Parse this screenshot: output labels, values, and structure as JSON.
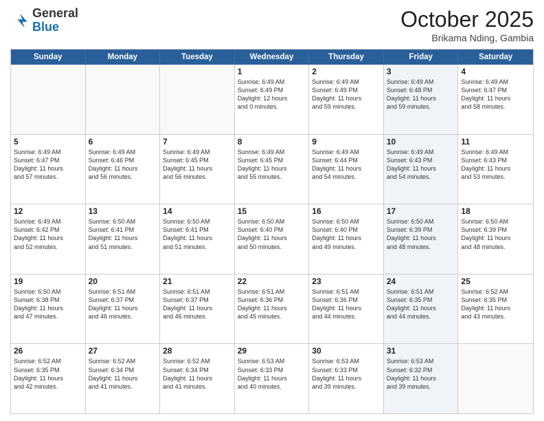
{
  "header": {
    "logo_general": "General",
    "logo_blue": "Blue",
    "month": "October 2025",
    "location": "Brikama Nding, Gambia"
  },
  "weekdays": [
    "Sunday",
    "Monday",
    "Tuesday",
    "Wednesday",
    "Thursday",
    "Friday",
    "Saturday"
  ],
  "weeks": [
    [
      {
        "day": "",
        "text": "",
        "empty": true
      },
      {
        "day": "",
        "text": "",
        "empty": true
      },
      {
        "day": "",
        "text": "",
        "empty": true
      },
      {
        "day": "1",
        "text": "Sunrise: 6:49 AM\nSunset: 6:49 PM\nDaylight: 12 hours\nand 0 minutes.",
        "shaded": false
      },
      {
        "day": "2",
        "text": "Sunrise: 6:49 AM\nSunset: 6:49 PM\nDaylight: 11 hours\nand 59 minutes.",
        "shaded": false
      },
      {
        "day": "3",
        "text": "Sunrise: 6:49 AM\nSunset: 6:48 PM\nDaylight: 11 hours\nand 59 minutes.",
        "shaded": true
      },
      {
        "day": "4",
        "text": "Sunrise: 6:49 AM\nSunset: 6:47 PM\nDaylight: 11 hours\nand 58 minutes.",
        "shaded": false
      }
    ],
    [
      {
        "day": "5",
        "text": "Sunrise: 6:49 AM\nSunset: 6:47 PM\nDaylight: 11 hours\nand 57 minutes.",
        "shaded": false
      },
      {
        "day": "6",
        "text": "Sunrise: 6:49 AM\nSunset: 6:46 PM\nDaylight: 11 hours\nand 56 minutes.",
        "shaded": false
      },
      {
        "day": "7",
        "text": "Sunrise: 6:49 AM\nSunset: 6:45 PM\nDaylight: 11 hours\nand 56 minutes.",
        "shaded": false
      },
      {
        "day": "8",
        "text": "Sunrise: 6:49 AM\nSunset: 6:45 PM\nDaylight: 11 hours\nand 55 minutes.",
        "shaded": false
      },
      {
        "day": "9",
        "text": "Sunrise: 6:49 AM\nSunset: 6:44 PM\nDaylight: 11 hours\nand 54 minutes.",
        "shaded": false
      },
      {
        "day": "10",
        "text": "Sunrise: 6:49 AM\nSunset: 6:43 PM\nDaylight: 11 hours\nand 54 minutes.",
        "shaded": true
      },
      {
        "day": "11",
        "text": "Sunrise: 6:49 AM\nSunset: 6:43 PM\nDaylight: 11 hours\nand 53 minutes.",
        "shaded": false
      }
    ],
    [
      {
        "day": "12",
        "text": "Sunrise: 6:49 AM\nSunset: 6:42 PM\nDaylight: 11 hours\nand 52 minutes.",
        "shaded": false
      },
      {
        "day": "13",
        "text": "Sunrise: 6:50 AM\nSunset: 6:41 PM\nDaylight: 11 hours\nand 51 minutes.",
        "shaded": false
      },
      {
        "day": "14",
        "text": "Sunrise: 6:50 AM\nSunset: 6:41 PM\nDaylight: 11 hours\nand 51 minutes.",
        "shaded": false
      },
      {
        "day": "15",
        "text": "Sunrise: 6:50 AM\nSunset: 6:40 PM\nDaylight: 11 hours\nand 50 minutes.",
        "shaded": false
      },
      {
        "day": "16",
        "text": "Sunrise: 6:50 AM\nSunset: 6:40 PM\nDaylight: 11 hours\nand 49 minutes.",
        "shaded": false
      },
      {
        "day": "17",
        "text": "Sunrise: 6:50 AM\nSunset: 6:39 PM\nDaylight: 11 hours\nand 48 minutes.",
        "shaded": true
      },
      {
        "day": "18",
        "text": "Sunrise: 6:50 AM\nSunset: 6:39 PM\nDaylight: 11 hours\nand 48 minutes.",
        "shaded": false
      }
    ],
    [
      {
        "day": "19",
        "text": "Sunrise: 6:50 AM\nSunset: 6:38 PM\nDaylight: 11 hours\nand 47 minutes.",
        "shaded": false
      },
      {
        "day": "20",
        "text": "Sunrise: 6:51 AM\nSunset: 6:37 PM\nDaylight: 11 hours\nand 46 minutes.",
        "shaded": false
      },
      {
        "day": "21",
        "text": "Sunrise: 6:51 AM\nSunset: 6:37 PM\nDaylight: 11 hours\nand 46 minutes.",
        "shaded": false
      },
      {
        "day": "22",
        "text": "Sunrise: 6:51 AM\nSunset: 6:36 PM\nDaylight: 11 hours\nand 45 minutes.",
        "shaded": false
      },
      {
        "day": "23",
        "text": "Sunrise: 6:51 AM\nSunset: 6:36 PM\nDaylight: 11 hours\nand 44 minutes.",
        "shaded": false
      },
      {
        "day": "24",
        "text": "Sunrise: 6:51 AM\nSunset: 6:35 PM\nDaylight: 11 hours\nand 44 minutes.",
        "shaded": true
      },
      {
        "day": "25",
        "text": "Sunrise: 6:52 AM\nSunset: 6:35 PM\nDaylight: 11 hours\nand 43 minutes.",
        "shaded": false
      }
    ],
    [
      {
        "day": "26",
        "text": "Sunrise: 6:52 AM\nSunset: 6:35 PM\nDaylight: 11 hours\nand 42 minutes.",
        "shaded": false
      },
      {
        "day": "27",
        "text": "Sunrise: 6:52 AM\nSunset: 6:34 PM\nDaylight: 11 hours\nand 41 minutes.",
        "shaded": false
      },
      {
        "day": "28",
        "text": "Sunrise: 6:52 AM\nSunset: 6:34 PM\nDaylight: 11 hours\nand 41 minutes.",
        "shaded": false
      },
      {
        "day": "29",
        "text": "Sunrise: 6:53 AM\nSunset: 6:33 PM\nDaylight: 11 hours\nand 40 minutes.",
        "shaded": false
      },
      {
        "day": "30",
        "text": "Sunrise: 6:53 AM\nSunset: 6:33 PM\nDaylight: 11 hours\nand 39 minutes.",
        "shaded": false
      },
      {
        "day": "31",
        "text": "Sunrise: 6:53 AM\nSunset: 6:32 PM\nDaylight: 11 hours\nand 39 minutes.",
        "shaded": true
      },
      {
        "day": "",
        "text": "",
        "empty": true
      }
    ]
  ]
}
